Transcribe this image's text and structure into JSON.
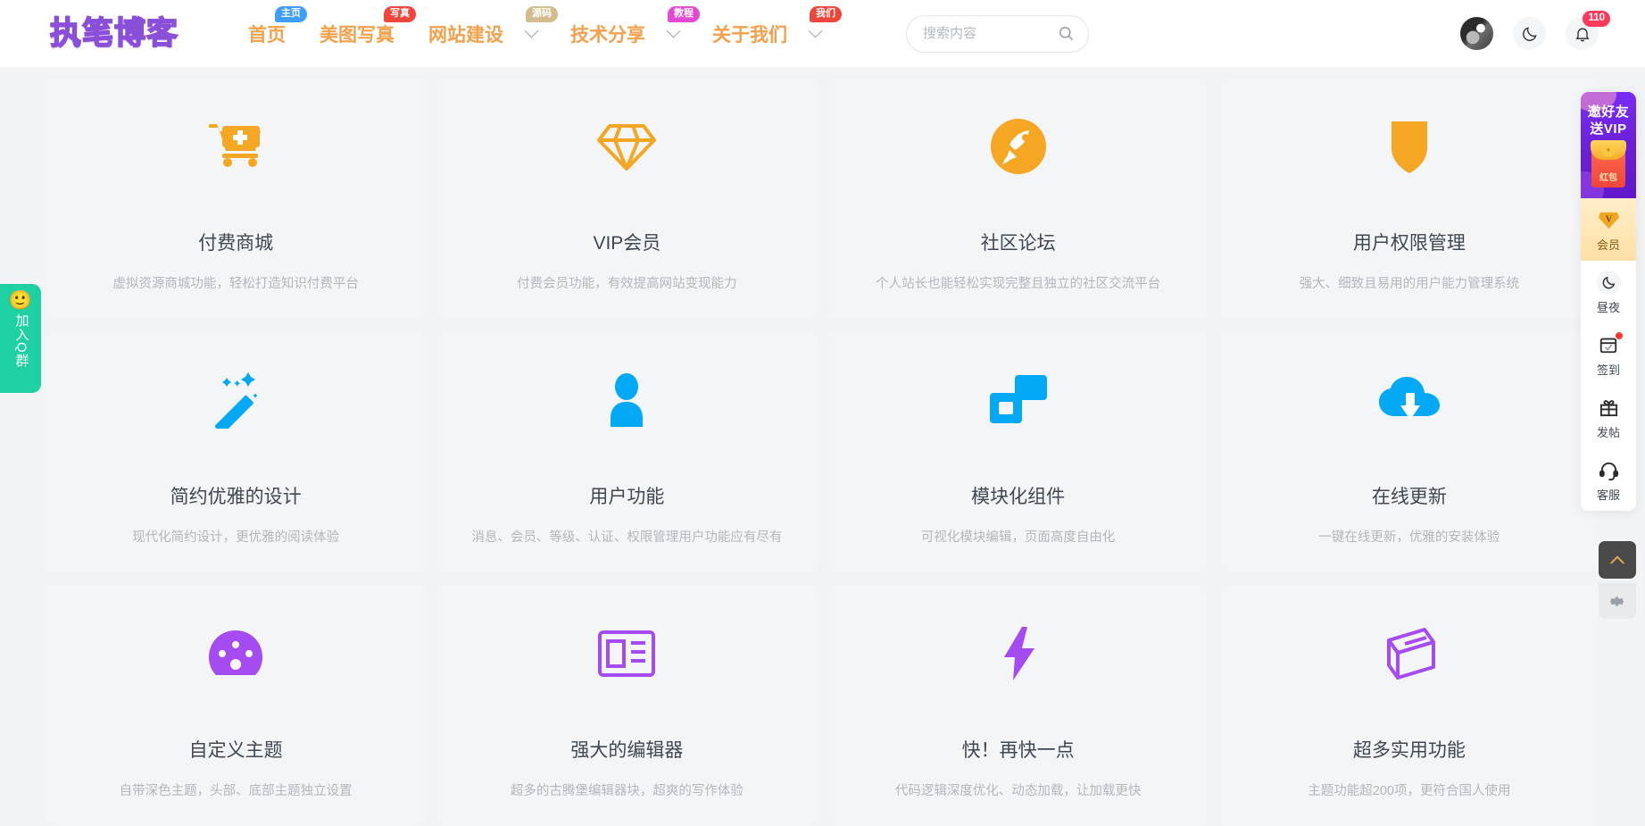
{
  "header": {
    "logo": "执笔博客",
    "nav": [
      {
        "label": "首页",
        "badge": "主页",
        "badge_color": "#3d9eff",
        "caret": false
      },
      {
        "label": "美图写真",
        "badge": "写真",
        "badge_color": "#f0453a",
        "caret": false
      },
      {
        "label": "网站建设",
        "badge": "源码",
        "badge_color": "#d3bc8e",
        "caret": true
      },
      {
        "label": "技术分享",
        "badge": "教程",
        "badge_color": "#e648d6",
        "caret": true
      },
      {
        "label": "关于我们",
        "badge": "我们",
        "badge_color": "#f0453a",
        "caret": true
      }
    ],
    "search": {
      "placeholder": "搜索内容",
      "value": "",
      "icon": "search-icon"
    },
    "avatar_icon": "user-avatar",
    "dark_mode_icon": "moon-icon",
    "notify_icon": "bell-icon",
    "notify_count": "110"
  },
  "cards": [
    {
      "title": "付费商城",
      "desc": "虚拟资源商城功能，轻松打造知识付费平台",
      "icon": "shopping-cart-plus-icon",
      "color": "#f5a623"
    },
    {
      "title": "VIP会员",
      "desc": "付费会员功能，有效提高网站变现能力",
      "icon": "diamond-icon",
      "color": "#f5a623"
    },
    {
      "title": "社区论坛",
      "desc": "个人站长也能轻松实现完整且独立的社区交流平台",
      "icon": "rocket-circle-icon",
      "color": "#f5a623"
    },
    {
      "title": "用户权限管理",
      "desc": "强大、细致且易用的用户能力管理系统",
      "icon": "shield-icon",
      "color": "#f5a623"
    },
    {
      "title": "简约优雅的设计",
      "desc": "现代化简约设计，更优雅的阅读体验",
      "icon": "magic-wand-icon",
      "color": "#03a9f4"
    },
    {
      "title": "用户功能",
      "desc": "消息、会员、等级、认证、权限管理用户功能应有尽有",
      "icon": "user-icon",
      "color": "#03a9f4"
    },
    {
      "title": "模块化组件",
      "desc": "可视化模块编辑，页面高度自由化",
      "icon": "modules-icon",
      "color": "#03a9f4"
    },
    {
      "title": "在线更新",
      "desc": "一键在线更新，优雅的安装体验",
      "icon": "cloud-download-icon",
      "color": "#03a9f4"
    },
    {
      "title": "自定义主题",
      "desc": "自带深色主题，头部、底部主题独立设置",
      "icon": "dashboard-icon",
      "color": "#a44bf2"
    },
    {
      "title": "强大的编辑器",
      "desc": "超多的古腾堡编辑器块，超爽的写作体验",
      "icon": "editor-icon",
      "color": "#a44bf2"
    },
    {
      "title": "快！再快一点",
      "desc": "代码逻辑深度优化、动态加载，让加载更快",
      "icon": "lightning-icon",
      "color": "#a44bf2"
    },
    {
      "title": "超多实用功能",
      "desc": "主题功能超200项，更符合国人使用",
      "icon": "book-icon",
      "color": "#a44bf2"
    }
  ],
  "qq_tab": {
    "emoji": "🙂",
    "text": "加入Q群"
  },
  "sidebar": {
    "promo": {
      "line1": "邀好友",
      "line2": "送VIP",
      "packet_label": "红包",
      "icon": "red-envelope-icon"
    },
    "items": [
      {
        "label": "会员",
        "icon": "vip-diamond-icon",
        "dot": false
      },
      {
        "label": "昼夜",
        "icon": "moon-icon",
        "dot": false
      },
      {
        "label": "签到",
        "icon": "calendar-check-icon",
        "dot": true
      },
      {
        "label": "发帖",
        "icon": "gift-icon",
        "dot": false
      },
      {
        "label": "客服",
        "icon": "headset-icon",
        "dot": false
      }
    ],
    "back_to_top_icon": "chevron-up-icon",
    "settings_icon": "gear-icon"
  }
}
